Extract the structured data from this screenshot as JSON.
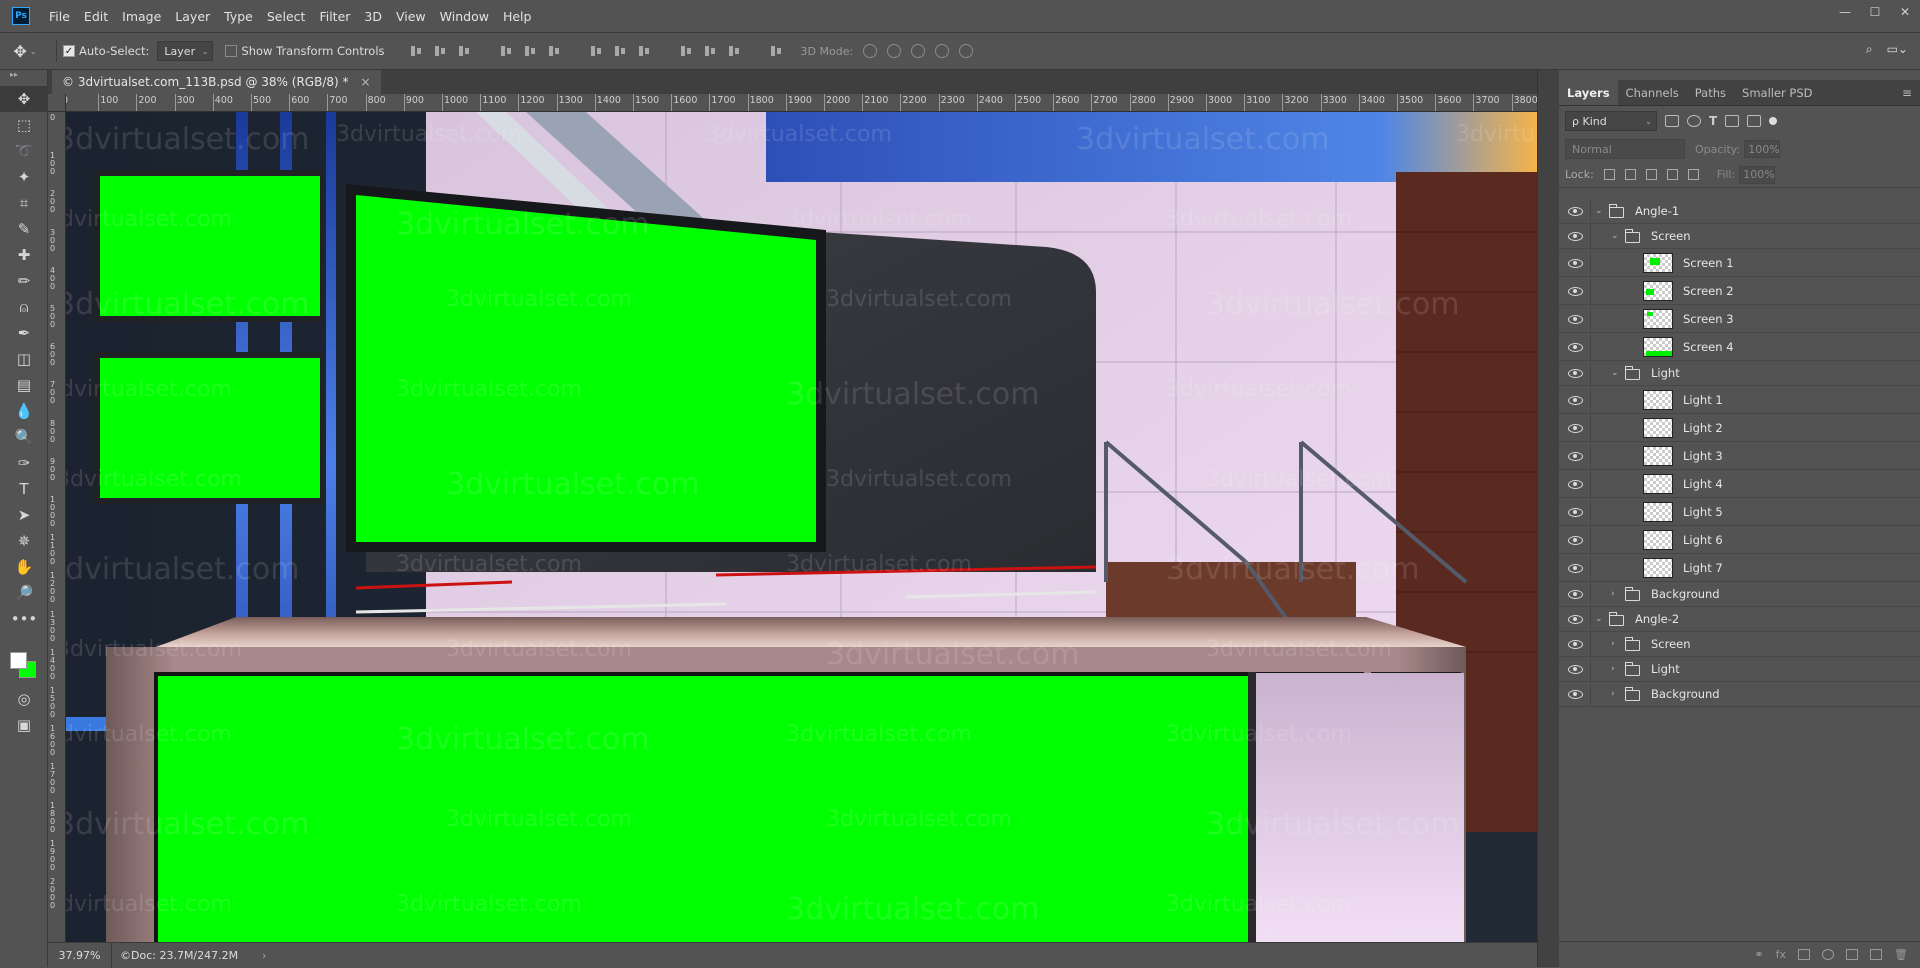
{
  "app": {
    "logo_text": "Ps"
  },
  "menu": [
    "File",
    "Edit",
    "Image",
    "Layer",
    "Type",
    "Select",
    "Filter",
    "3D",
    "View",
    "Window",
    "Help"
  ],
  "window_controls": {
    "minimize": "—",
    "maximize": "☐",
    "close": "✕"
  },
  "options": {
    "auto_select_label": "Auto-Select:",
    "auto_select_checked": true,
    "auto_select_target": "Layer",
    "transform_label": "Show Transform Controls",
    "transform_checked": false,
    "mode_3d_label": "3D Mode:"
  },
  "document": {
    "tab_title": "© 3dvirtualset.com_113B.psd @ 38% (RGB/8) *",
    "close": "×"
  },
  "ruler": {
    "top_labels": [
      "0",
      "100",
      "200",
      "300",
      "400",
      "500",
      "600",
      "700",
      "800",
      "900",
      "1000",
      "1100",
      "1200",
      "1300",
      "1400",
      "1500",
      "1600",
      "1700",
      "1800",
      "1900",
      "2000",
      "2100",
      "2200",
      "2300",
      "2400",
      "2500",
      "2600",
      "2700",
      "2800",
      "2900",
      "3000",
      "3100",
      "3200",
      "3300",
      "3400",
      "3500",
      "3600",
      "3700",
      "3800"
    ],
    "left_labels": [
      "0",
      "1 0 0",
      "2 0 0",
      "3 0 0",
      "4 0 0",
      "5 0 0",
      "6 0 0",
      "7 0 0",
      "8 0 0",
      "9 0 0",
      "1 0 0 0",
      "1 1 0 0",
      "1 2 0 0",
      "1 3 0 0",
      "1 4 0 0",
      "1 5 0 0",
      "1 6 0 0",
      "1 7 0 0",
      "1 8 0 0",
      "1 9 0 0",
      "2 0 0 0"
    ]
  },
  "watermark": "3dvirtualset.com",
  "status": {
    "zoom": "37.97%",
    "doc": "©Doc: 23.7M/247.2M",
    "arrow": "›"
  },
  "tools": [
    "move-tool",
    "marquee-tool",
    "lasso-tool",
    "magic-wand-tool",
    "crop-tool",
    "eyedropper-tool",
    "healing-tool",
    "brush-tool",
    "stamp-tool",
    "history-brush-tool",
    "eraser-tool",
    "gradient-tool",
    "blur-tool",
    "dodge-tool",
    "pen-tool",
    "type-tool",
    "path-select-tool",
    "shape-tool",
    "hand-tool",
    "zoom-tool",
    "more-tools"
  ],
  "tool_glyphs": [
    "✥",
    "⬚",
    "➰",
    "✦",
    "⌗",
    "✎",
    "✚",
    "✏",
    "⍝",
    "✒",
    "◫",
    "▤",
    "💧",
    "🔍",
    "✑",
    "T",
    "➤",
    "✵",
    "✋",
    "🔎",
    "•••"
  ],
  "swatches": {
    "foreground": "#ffffff",
    "background": "#00ff00"
  },
  "panel": {
    "tabs": [
      "Layers",
      "Channels",
      "Paths",
      "Smaller PSD"
    ],
    "active_tab": "Layers",
    "kind_label": "ρ Kind",
    "blend_mode": "Normal",
    "opacity_label": "Opacity:",
    "opacity_value": "100%",
    "lock_label": "Lock:",
    "fill_label": "Fill:",
    "fill_value": "100%"
  },
  "layers": [
    {
      "name": "Angle-1",
      "type": "group",
      "depth": 0,
      "expanded": true,
      "visible": true
    },
    {
      "name": "Screen",
      "type": "group",
      "depth": 1,
      "expanded": true,
      "visible": true
    },
    {
      "name": "Screen 1",
      "type": "layer",
      "depth": 2,
      "visible": true,
      "thumb": "screen1"
    },
    {
      "name": "Screen 2",
      "type": "layer",
      "depth": 2,
      "visible": true,
      "thumb": "screen2"
    },
    {
      "name": "Screen 3",
      "type": "layer",
      "depth": 2,
      "visible": true,
      "thumb": "screen3"
    },
    {
      "name": "Screen 4",
      "type": "layer",
      "depth": 2,
      "visible": true,
      "thumb": "screen4"
    },
    {
      "name": "Light",
      "type": "group",
      "depth": 1,
      "expanded": true,
      "visible": true
    },
    {
      "name": "Light 1",
      "type": "layer",
      "depth": 2,
      "visible": true,
      "thumb": "empty"
    },
    {
      "name": "Light 2",
      "type": "layer",
      "depth": 2,
      "visible": true,
      "thumb": "empty"
    },
    {
      "name": "Light 3",
      "type": "layer",
      "depth": 2,
      "visible": true,
      "thumb": "empty"
    },
    {
      "name": "Light 4",
      "type": "layer",
      "depth": 2,
      "visible": true,
      "thumb": "empty"
    },
    {
      "name": "Light 5",
      "type": "layer",
      "depth": 2,
      "visible": true,
      "thumb": "empty"
    },
    {
      "name": "Light 6",
      "type": "layer",
      "depth": 2,
      "visible": true,
      "thumb": "empty"
    },
    {
      "name": "Light 7",
      "type": "layer",
      "depth": 2,
      "visible": true,
      "thumb": "empty"
    },
    {
      "name": "Background",
      "type": "group",
      "depth": 1,
      "expanded": false,
      "visible": true
    },
    {
      "name": "Angle-2",
      "type": "group",
      "depth": 0,
      "expanded": true,
      "visible": true
    },
    {
      "name": "Screen",
      "type": "group",
      "depth": 1,
      "expanded": false,
      "visible": true
    },
    {
      "name": "Light",
      "type": "group",
      "depth": 1,
      "expanded": false,
      "visible": true
    },
    {
      "name": "Background",
      "type": "group",
      "depth": 1,
      "expanded": false,
      "visible": true
    }
  ],
  "colors": {
    "chroma_green": "#00ff00",
    "ui_bg": "#535353",
    "panel_dark": "#424242"
  }
}
